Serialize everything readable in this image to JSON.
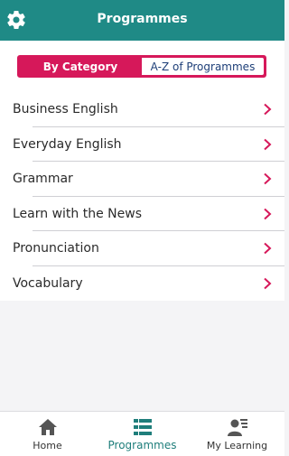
{
  "header": {
    "title": "Programmes"
  },
  "segments": {
    "by_category": "By Category",
    "a_to_z": "A-Z of Programmes"
  },
  "categories": [
    {
      "label": "Business English"
    },
    {
      "label": "Everyday English"
    },
    {
      "label": "Grammar"
    },
    {
      "label": "Learn with the News"
    },
    {
      "label": "Pronunciation"
    },
    {
      "label": "Vocabulary"
    }
  ],
  "tabs": {
    "home": "Home",
    "programmes": "Programmes",
    "my_learning": "My Learning"
  },
  "icons": {
    "settings": "gear-icon",
    "row_chevron": "chevron-right-icon",
    "home": "home-icon",
    "programmes": "list-icon",
    "my_learning": "person-list-icon"
  },
  "colors": {
    "header": "#1f8a86",
    "accent": "#d6185a",
    "segment_inactive_text": "#1e3f78",
    "active_tab": "#1f7e7b"
  }
}
